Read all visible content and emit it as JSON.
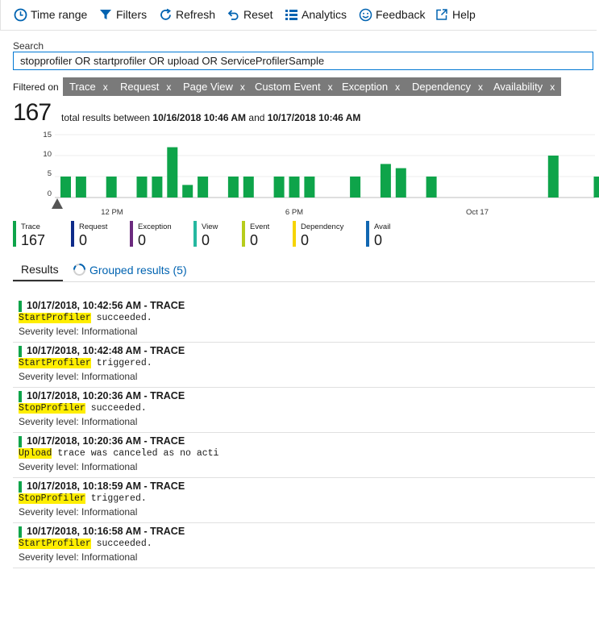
{
  "toolbar": {
    "time_range": "Time range",
    "filters": "Filters",
    "refresh": "Refresh",
    "reset": "Reset",
    "analytics": "Analytics",
    "feedback": "Feedback",
    "help": "Help"
  },
  "search": {
    "label": "Search",
    "value": "stopprofiler OR startprofiler OR upload OR ServiceProfilerSample"
  },
  "filters": {
    "label": "Filtered on",
    "chips": [
      "Trace",
      "Request",
      "Page View",
      "Custom Event",
      "Exception",
      "Dependency",
      "Availability"
    ],
    "remove_glyph": "x"
  },
  "summary": {
    "count": "167",
    "prefix": "total results between",
    "start": "10/16/2018 10:46 AM",
    "middle": "and",
    "end": "10/17/2018 10:46 AM"
  },
  "chart_data": {
    "type": "bar",
    "x_tick_labels": [
      "12 PM",
      "6 PM",
      "Oct 17"
    ],
    "y_tick_labels": [
      "15",
      "10",
      "5",
      "0"
    ],
    "ylim": [
      0,
      15
    ],
    "grid": true,
    "color": "#0ea44a",
    "bars": [
      {
        "bin": 1,
        "value": 5
      },
      {
        "bin": 2,
        "value": 5
      },
      {
        "bin": 4,
        "value": 5
      },
      {
        "bin": 6,
        "value": 5
      },
      {
        "bin": 7,
        "value": 5
      },
      {
        "bin": 8,
        "value": 12
      },
      {
        "bin": 9,
        "value": 3
      },
      {
        "bin": 10,
        "value": 5
      },
      {
        "bin": 12,
        "value": 5
      },
      {
        "bin": 13,
        "value": 5
      },
      {
        "bin": 15,
        "value": 5
      },
      {
        "bin": 16,
        "value": 5
      },
      {
        "bin": 17,
        "value": 5
      },
      {
        "bin": 20,
        "value": 5
      },
      {
        "bin": 22,
        "value": 8
      },
      {
        "bin": 23,
        "value": 7
      },
      {
        "bin": 25,
        "value": 5
      },
      {
        "bin": 33,
        "value": 10
      },
      {
        "bin": 36,
        "value": 5
      }
    ]
  },
  "legend": [
    {
      "label": "Trace",
      "value": "167",
      "color": "#0ea44a"
    },
    {
      "label": "Request",
      "value": "0",
      "color": "#0e2b8a"
    },
    {
      "label": "Exception",
      "value": "0",
      "color": "#6b2a7e"
    },
    {
      "label": "View",
      "value": "0",
      "color": "#25b8a0"
    },
    {
      "label": "Event",
      "value": "0",
      "color": "#b7cc1c"
    },
    {
      "label": "Dependency",
      "value": "0",
      "color": "#f6d400"
    },
    {
      "label": "Avail",
      "value": "0",
      "color": "#1167b1"
    }
  ],
  "tabs": {
    "results": "Results",
    "grouped": "Grouped results (5)"
  },
  "results": [
    {
      "timestamp": "10/17/2018, 10:42:56 AM - TRACE",
      "highlight": "StartProfiler",
      "rest": " succeeded.",
      "severity": "Severity level: Informational"
    },
    {
      "timestamp": "10/17/2018, 10:42:48 AM - TRACE",
      "highlight": "StartProfiler",
      "rest": " triggered.",
      "severity": "Severity level: Informational"
    },
    {
      "timestamp": "10/17/2018, 10:20:36 AM - TRACE",
      "highlight": "StopProfiler",
      "rest": " succeeded.",
      "severity": "Severity level: Informational"
    },
    {
      "timestamp": "10/17/2018, 10:20:36 AM - TRACE",
      "highlight": "Upload",
      "rest": " trace was canceled as no acti",
      "severity": "Severity level: Informational"
    },
    {
      "timestamp": "10/17/2018, 10:18:59 AM - TRACE",
      "highlight": "StopProfiler",
      "rest": " triggered.",
      "severity": "Severity level: Informational"
    },
    {
      "timestamp": "10/17/2018, 10:16:58 AM - TRACE",
      "highlight": "StartProfiler",
      "rest": " succeeded.",
      "severity": "Severity level: Informational"
    }
  ]
}
